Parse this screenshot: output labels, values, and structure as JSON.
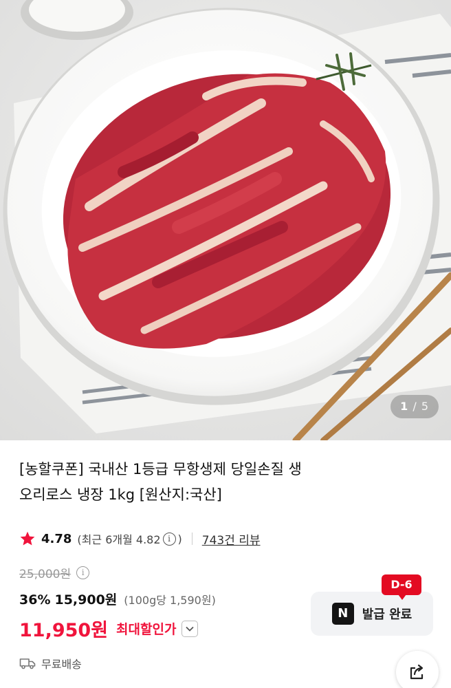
{
  "gallery": {
    "current": "1",
    "separator": "/",
    "total": "5",
    "image_alt": "duck-breast-on-plate-photo"
  },
  "product": {
    "title_line1": "[농할쿠폰] 국내산 1등급 무항생제 당일손질 생",
    "title_line2": "오리로스 냉장 1kg [원산지:국산]"
  },
  "rating": {
    "value": "4.78",
    "recent_prefix": "(최근 6개월 4.82",
    "recent_suffix": ")",
    "info_icon": "i",
    "review_count": "743건 리뷰",
    "star_color": "#f0143c"
  },
  "price": {
    "original": "25,000원",
    "discount_percent": "36%",
    "discount_price": "15,900원",
    "unit_price": "(100g당 1,590원)",
    "max_discount_amount": "11,950원",
    "max_discount_label": "최대할인가",
    "accent_color": "#f0143c"
  },
  "shipping": {
    "label": "무료배송",
    "icon": "truck-icon"
  },
  "coupon": {
    "badge": "D-6",
    "logo": "N",
    "label": "발급 완료"
  },
  "share": {
    "icon": "share-icon"
  }
}
